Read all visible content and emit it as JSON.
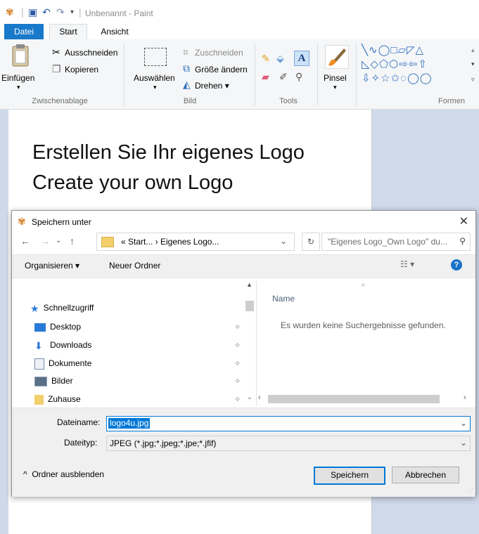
{
  "window": {
    "title": "Unbenannt - Paint"
  },
  "tabs": {
    "file": "Datei",
    "start": "Start",
    "view": "Ansicht"
  },
  "ribbon": {
    "clipboard": {
      "paste": "Einfügen",
      "cut": "Ausschneiden",
      "copy": "Kopieren",
      "group": "Zwischenablage"
    },
    "image": {
      "select": "Auswählen",
      "crop": "Zuschneiden",
      "resize": "Größe ändern",
      "rotate": "Drehen ▾",
      "group": "Bild"
    },
    "tools": {
      "group": "Tools"
    },
    "brush": {
      "label": "Pinsel"
    },
    "shapes": {
      "group": "Formen",
      "row1": "╲∿◯□▱◸△",
      "row2": "◺◇⬠⬡⇨⇦⇧",
      "row3": "⇩✧☆✩◌◯◯"
    }
  },
  "canvas": {
    "line1": "Erstellen Sie Ihr eigenes Logo",
    "line2": "Create your own Logo"
  },
  "dialog": {
    "title": "Speichern unter",
    "breadcrumb": "« Start... › Eigenes Logo...",
    "search_placeholder": "\"Eigenes Logo_Own Logo\" du...",
    "organize": "Organisieren ▾",
    "new_folder": "Neuer Ordner",
    "nav": [
      {
        "label": "Schnellzugriff"
      },
      {
        "label": "Desktop"
      },
      {
        "label": "Downloads"
      },
      {
        "label": "Dokumente"
      },
      {
        "label": "Bilder"
      },
      {
        "label": "Zuhause"
      }
    ],
    "column_name": "Name",
    "empty_message": "Es wurden keine Suchergebnisse gefunden.",
    "filename_label": "Dateiname:",
    "filename_value": "logo4u.jpg",
    "filetype_label": "Dateityp:",
    "filetype_value": "JPEG (*.jpg;*.jpeg;*.jpe;*.jfif)",
    "save": "Speichern",
    "cancel": "Abbrechen",
    "hide_folders": "Ordner ausblenden"
  },
  "colors": {
    "accent": "#1979ca",
    "selection": "#0078d7",
    "canvas_bg": "#cfd9ea"
  }
}
